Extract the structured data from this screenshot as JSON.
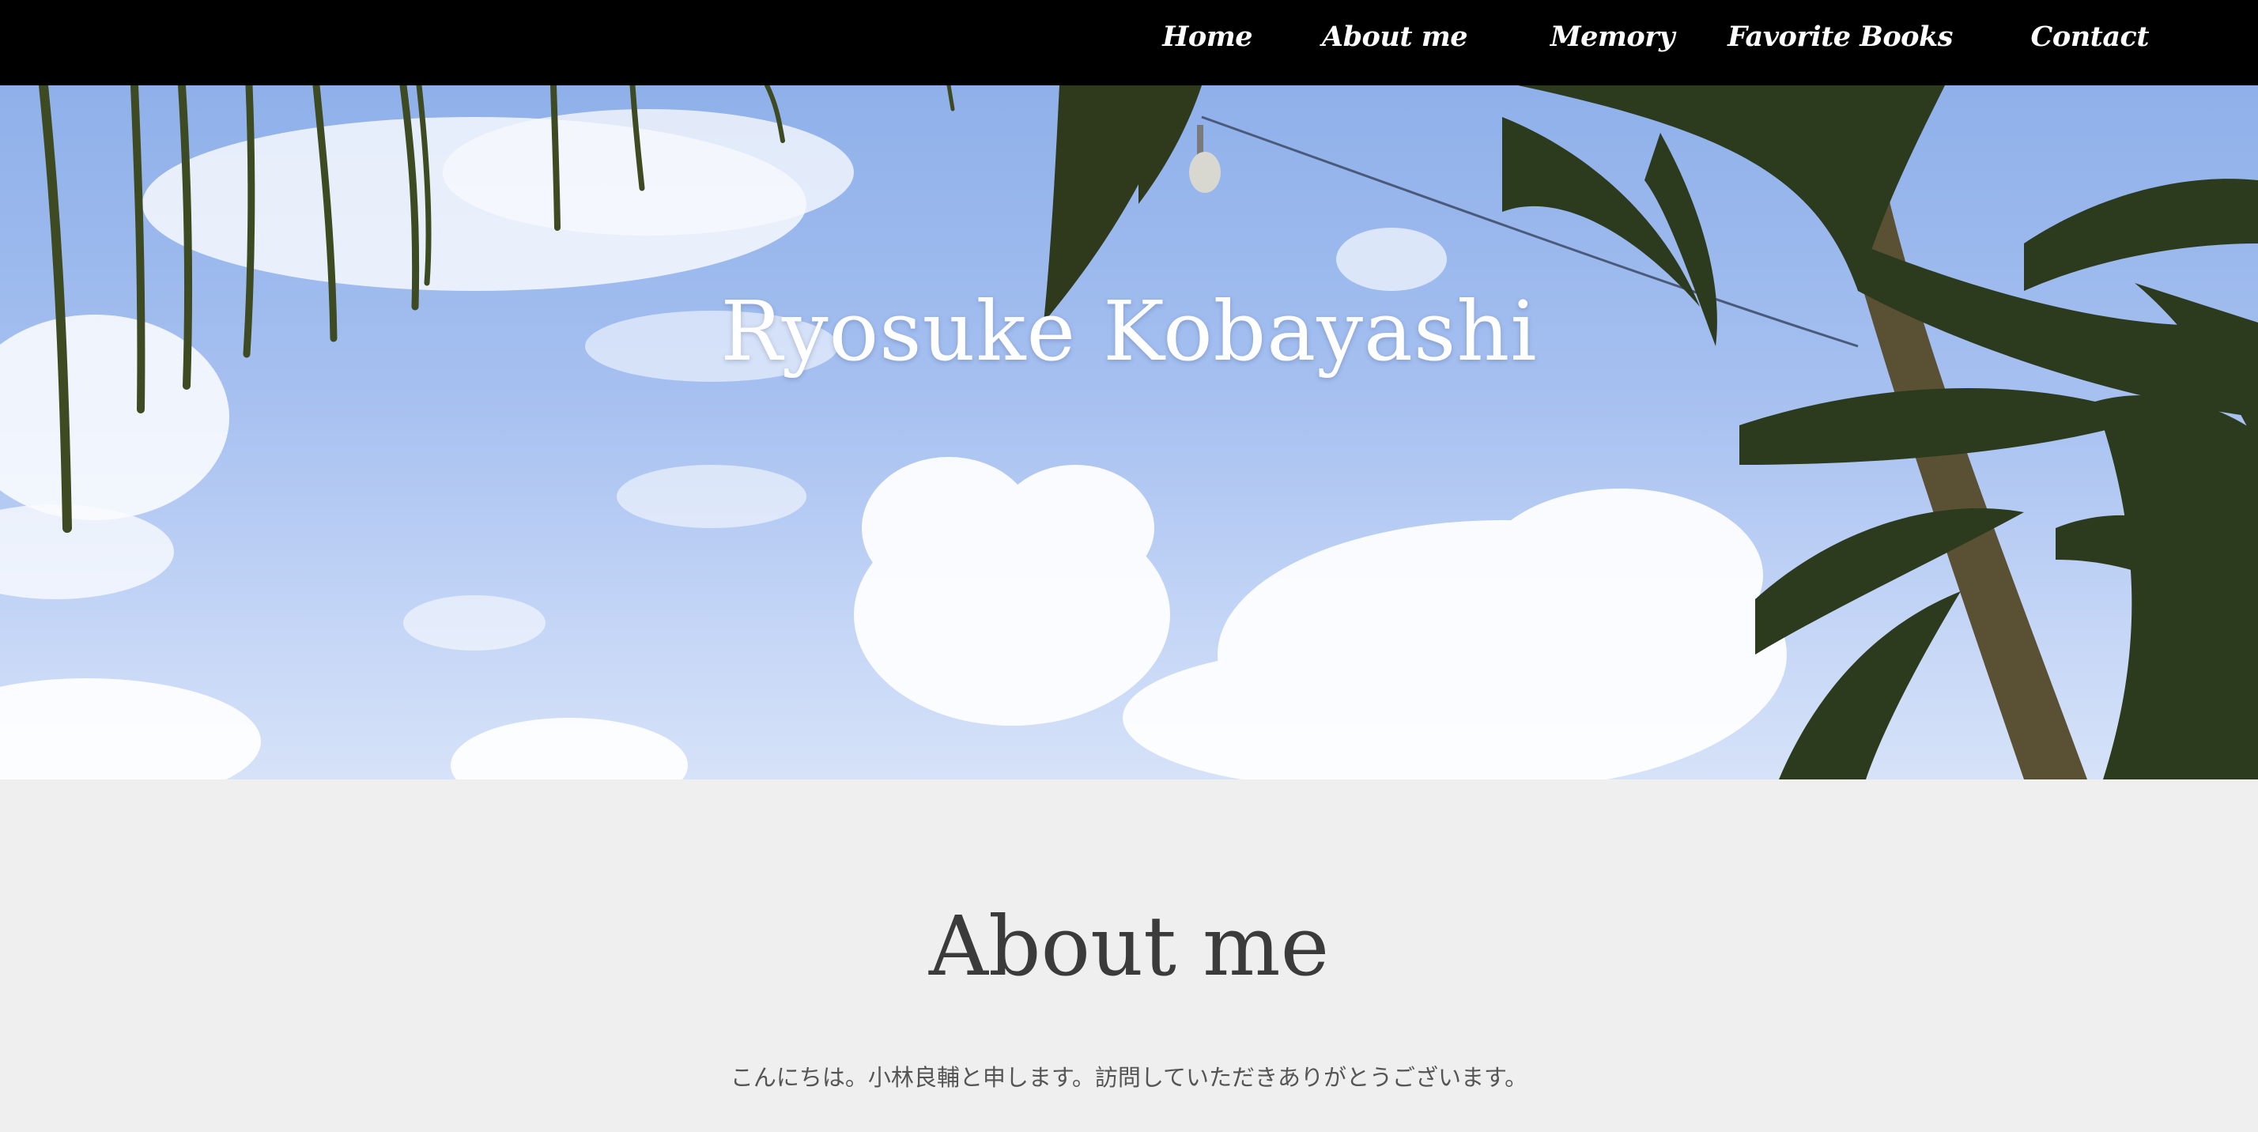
{
  "nav": {
    "items": [
      "Home",
      "About me",
      "Memory",
      "Favorite Books",
      "Contact"
    ]
  },
  "hero": {
    "title": "Ryosuke Kobayashi"
  },
  "about": {
    "heading": "About me",
    "intro": "こんにちは。小林良輔と申します。訪問していただきありがとうございます。"
  },
  "colors": {
    "navbar": "#000000",
    "nav_text": "#ffffff",
    "sky": "#a6c0f0",
    "section_bg": "#efefef",
    "heading_text": "#3b3b3b"
  }
}
